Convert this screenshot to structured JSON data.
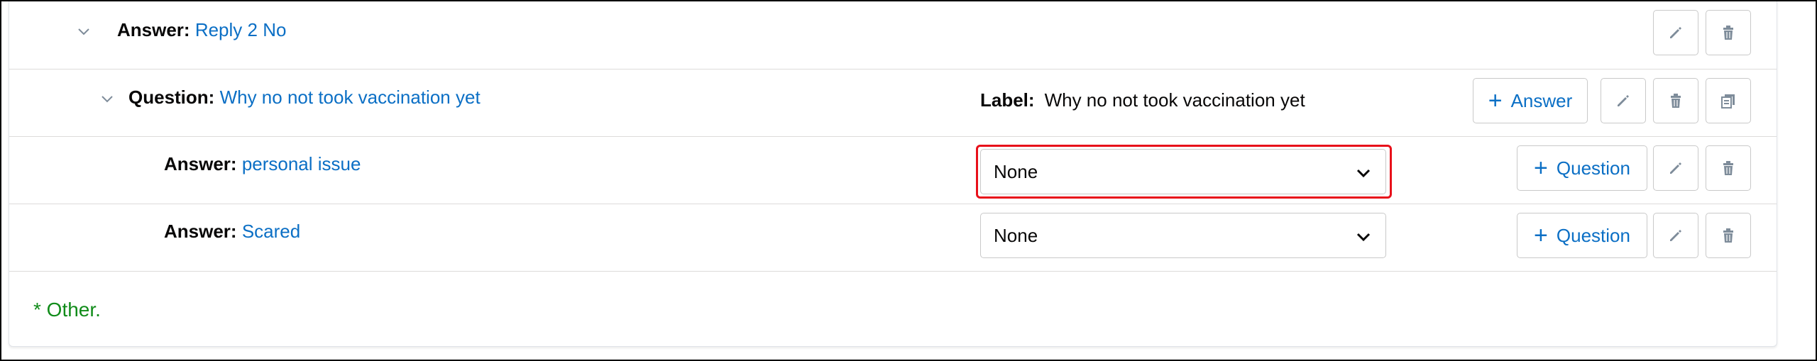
{
  "rows": [
    {
      "key": "Answer:",
      "value": "Reply 2 No",
      "chevron_icon": "chevron-down-icon",
      "actions": [
        "edit-icon",
        "delete-icon"
      ]
    },
    {
      "key": "Question:",
      "value": "Why no not took vaccination yet",
      "label_key": "Label:",
      "label_value": "Why no not took vaccination yet",
      "add_button": "Answer",
      "actions": [
        "edit-icon",
        "delete-icon",
        "copy-icon"
      ]
    },
    {
      "key": "Answer:",
      "value": "personal issue",
      "select_value": "None",
      "add_button": "Question",
      "actions": [
        "edit-icon",
        "delete-icon"
      ]
    },
    {
      "key": "Answer:",
      "value": "Scared",
      "select_value": "None",
      "add_button": "Question",
      "actions": [
        "edit-icon",
        "delete-icon"
      ]
    }
  ],
  "footer": {
    "other_text": "* Other."
  },
  "colors": {
    "link": "#0b6fc5",
    "highlight": "#e8101a",
    "other": "#118c1a",
    "icon": "#7e8c9a"
  }
}
